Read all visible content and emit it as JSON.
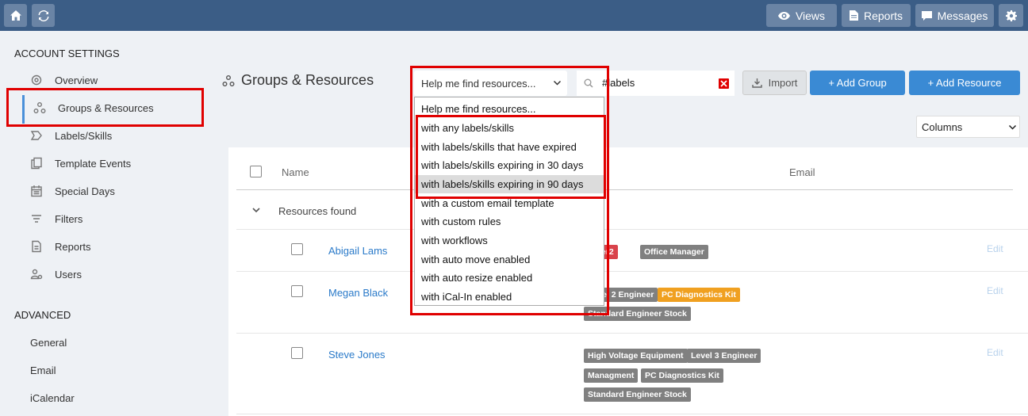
{
  "topbar": {
    "views_label": "Views",
    "reports_label": "Reports",
    "messages_label": "Messages"
  },
  "sidebar": {
    "account_heading": "ACCOUNT SETTINGS",
    "items": [
      {
        "label": "Overview",
        "icon": "gear-icon"
      },
      {
        "label": "Groups & Resources",
        "icon": "groups-icon"
      },
      {
        "label": "Labels/Skills",
        "icon": "label-icon"
      },
      {
        "label": "Template Events",
        "icon": "copy-icon"
      },
      {
        "label": "Special Days",
        "icon": "calendar-icon"
      },
      {
        "label": "Filters",
        "icon": "filter-icon"
      },
      {
        "label": "Reports",
        "icon": "document-icon"
      },
      {
        "label": "Users",
        "icon": "users-icon"
      }
    ],
    "advanced_heading": "ADVANCED",
    "advanced_items": [
      "General",
      "Email",
      "iCalendar"
    ]
  },
  "main": {
    "title": "Groups & Resources",
    "filter_select": "Help me find resources...",
    "search_value": "#labels",
    "import_label": "Import",
    "add_group_label": "+ Add Group",
    "add_resource_label": "+ Add Resource",
    "columns_label": "Columns"
  },
  "table": {
    "headers": {
      "name": "Name",
      "email": "Email"
    },
    "group_label": "Resources found",
    "edit_label": "Edit",
    "rows": [
      {
        "name": "Abigail Lams",
        "tags": [
          "Rider2",
          "Office Manager"
        ]
      },
      {
        "name": "Megan Black",
        "tags": [
          "Level 2 Engineer",
          "PC Diagnostics Kit",
          "Standard Engineer Stock"
        ]
      },
      {
        "name": "Steve Jones",
        "tags": [
          "High Voltage Equipment",
          "Level 3 Engineer",
          "Managment",
          "PC Diagnostics Kit",
          "Standard Engineer Stock"
        ]
      }
    ]
  },
  "dropdown": {
    "options": [
      "Help me find resources...",
      "with any labels/skills",
      "with labels/skills that have expired",
      "with labels/skills expiring in 30 days",
      "with labels/skills expiring in 90 days",
      "with a custom email template",
      "with custom rules",
      "with workflows",
      "with auto move enabled",
      "with auto resize enabled",
      "with iCal-In enabled"
    ],
    "highlighted": "with labels/skills expiring in 90 days"
  },
  "colors": {
    "topbar": "#3b5d86",
    "primary": "#3a8ad4",
    "tag_gray": "#808080",
    "tag_red": "#d9434b",
    "tag_orange": "#f0a020",
    "highlight_border": "#e00000"
  }
}
